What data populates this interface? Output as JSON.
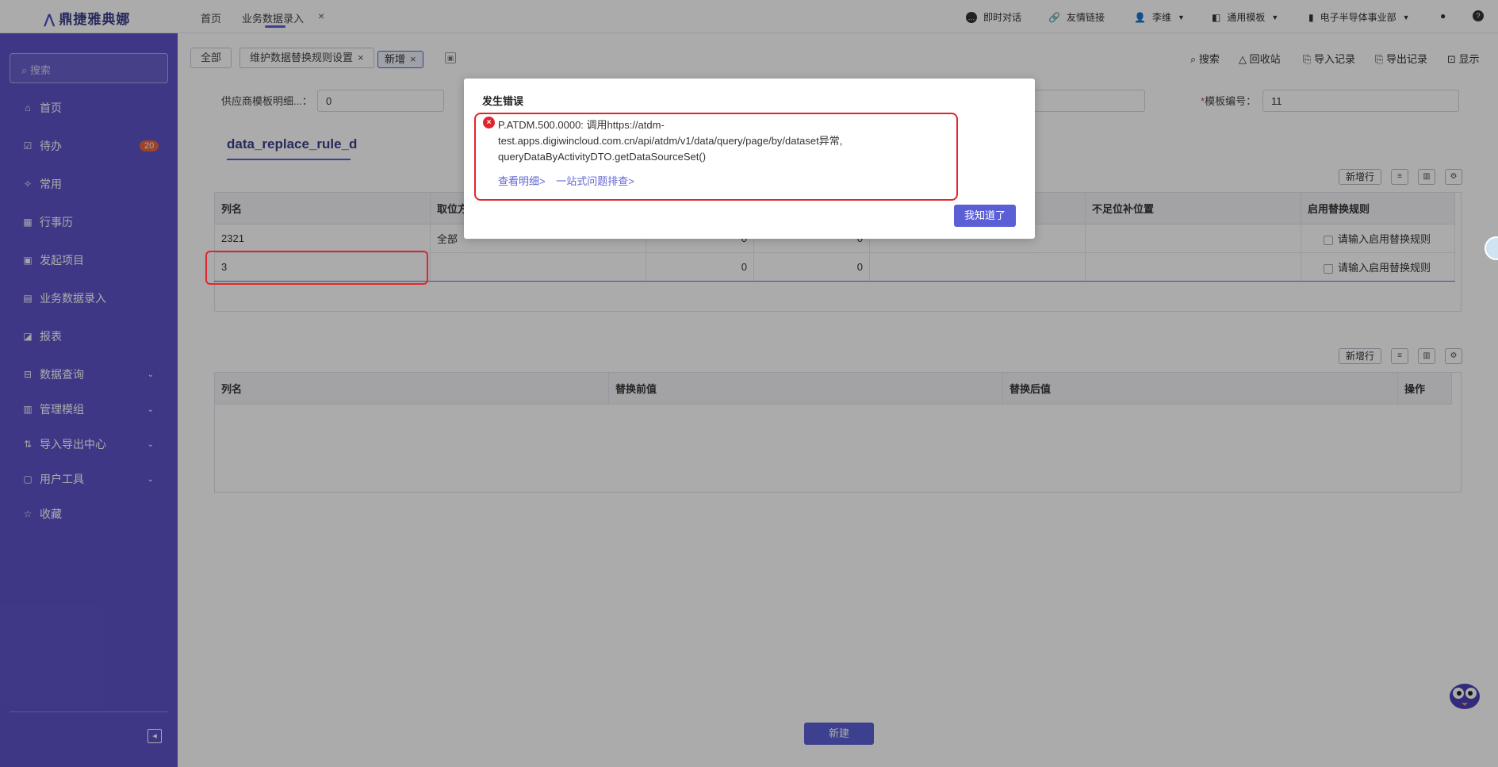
{
  "app": {
    "logo": "鼎捷雅典娜"
  },
  "topnav": {
    "home": "首页",
    "current_tab": "业务数据录入",
    "close": "×",
    "chat": "即时对话",
    "links": "友情链接",
    "user": "李维",
    "template": "通用模板",
    "dept": "电子半导体事业部"
  },
  "sidebar": {
    "search_placeholder": "搜索",
    "items": [
      {
        "label": "首页",
        "icon": "home-icon",
        "glyph": "⌂"
      },
      {
        "label": "待办",
        "icon": "todo-icon",
        "glyph": "☑",
        "badge": "20"
      },
      {
        "label": "常用",
        "icon": "pin-icon",
        "glyph": "✧"
      },
      {
        "label": "行事历",
        "icon": "calendar-icon",
        "glyph": "▦"
      },
      {
        "label": "发起项目",
        "icon": "project-icon",
        "glyph": "▣"
      },
      {
        "label": "业务数据录入",
        "icon": "data-entry-icon",
        "glyph": "▤"
      },
      {
        "label": "报表",
        "icon": "report-icon",
        "glyph": "◪"
      },
      {
        "label": "数据查询",
        "icon": "query-icon",
        "glyph": "⊟",
        "expandable": true
      },
      {
        "label": "管理模组",
        "icon": "module-icon",
        "glyph": "▥",
        "expandable": true
      },
      {
        "label": "导入导出中心",
        "icon": "import-export-icon",
        "glyph": "⇅",
        "expandable": true
      },
      {
        "label": "用户工具",
        "icon": "tools-icon",
        "glyph": "▢",
        "expandable": true
      },
      {
        "label": "收藏",
        "icon": "star-icon",
        "glyph": "☆"
      }
    ]
  },
  "tabs": {
    "all": "全部",
    "settings": "维护数据替换规则设置",
    "new": "新增"
  },
  "toolbar": {
    "search": "搜索",
    "recycle": "回收站",
    "import_log": "导入记录",
    "export_log": "导出记录",
    "display": "显示"
  },
  "form": {
    "supplier_label": "供应商模板明细...：",
    "supplier_value": "0",
    "template_no_label": "模板编号：",
    "template_no_value": "11"
  },
  "subtab": "data_replace_rule_d",
  "table1": {
    "add_row": "新增行",
    "headers": [
      "列名",
      "取位方式",
      "",
      "",
      "",
      "不足位补位置",
      "启用替换规则"
    ],
    "rows": [
      {
        "col_name": "2321",
        "mode": "全部",
        "n1": "0",
        "n2": "0",
        "pad": "",
        "rule": "请输入启用替换规则"
      },
      {
        "col_name": "3",
        "mode": "",
        "n1": "0",
        "n2": "0",
        "pad": "",
        "rule": "请输入启用替换规则"
      }
    ]
  },
  "table2": {
    "add_row": "新增行",
    "headers": [
      "列名",
      "替换前值",
      "替换后值",
      "操作"
    ]
  },
  "footer": {
    "create": "新建"
  },
  "dialog": {
    "title": "发生错误",
    "message_line1": "P.ATDM.500.0000: 调用https://atdm-",
    "message_line2": "test.apps.digiwincloud.com.cn/api/atdm/v1/data/query/page/by/dataset异常,",
    "message_line3": "queryDataByActivityDTO.getDataSourceSet()",
    "link_detail": "查看明细>",
    "link_troubleshoot": "一站式问题排查>",
    "ok": "我知道了"
  },
  "colors": {
    "accent": "#5b5fd6",
    "sidebar": "#5d53c8",
    "error": "#e0262b"
  }
}
